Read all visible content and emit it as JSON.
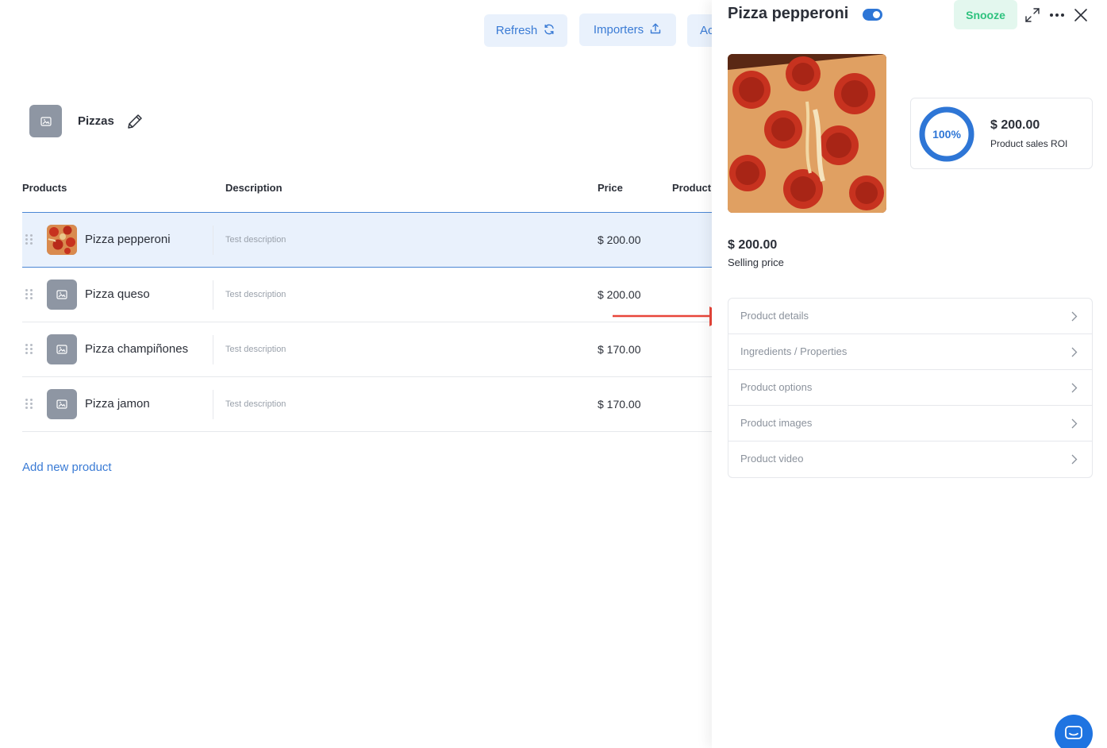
{
  "toolbar": {
    "refresh_label": "Refresh",
    "importers_label": "Importers",
    "add_label_truncated": "Ac"
  },
  "category": {
    "title": "Pizzas"
  },
  "table": {
    "columns": [
      "Products",
      "Description",
      "Price",
      "Product"
    ],
    "rows": [
      {
        "name": "Pizza pepperoni",
        "description": "Test description",
        "price": "$ 200.00",
        "selected": true,
        "has_photo": true
      },
      {
        "name": "Pizza queso",
        "description": "Test description",
        "price": "$ 200.00",
        "selected": false,
        "has_photo": false
      },
      {
        "name": "Pizza champiñones",
        "description": "Test description",
        "price": "$ 170.00",
        "selected": false,
        "has_photo": false
      },
      {
        "name": "Pizza jamon",
        "description": "Test description",
        "price": "$ 170.00",
        "selected": false,
        "has_photo": false
      }
    ]
  },
  "add_product_label": "Add new product",
  "drawer": {
    "title": "Pizza pepperoni",
    "active_toggle": true,
    "snooze_label": "Snooze",
    "roi": {
      "percent_label": "100%",
      "percent_value": 1.0,
      "value": "$ 200.00",
      "label": "Product sales ROI"
    },
    "selling_price": {
      "value": "$ 200.00",
      "label": "Selling price"
    },
    "menu": [
      "Product details",
      "Ingredients / Properties",
      "Product options",
      "Product images",
      "Product video"
    ]
  },
  "colors": {
    "accent": "#2e76d6",
    "accent_light": "#e9f1fc",
    "snooze_green": "#2ec27e",
    "snooze_bg": "#e3f7ee",
    "annotation_red": "#e8463a",
    "thumb_gray": "#8e96a3"
  },
  "icons": {
    "refresh": "refresh-icon",
    "importers": "upload-icon",
    "edit": "pencil-icon",
    "drag": "drag-handle-icon",
    "image_placeholder": "image-placeholder-icon",
    "expand": "expand-icon",
    "more": "more-icon",
    "close": "close-icon",
    "chevron": "chevron-right-icon",
    "chat": "chat-icon"
  }
}
